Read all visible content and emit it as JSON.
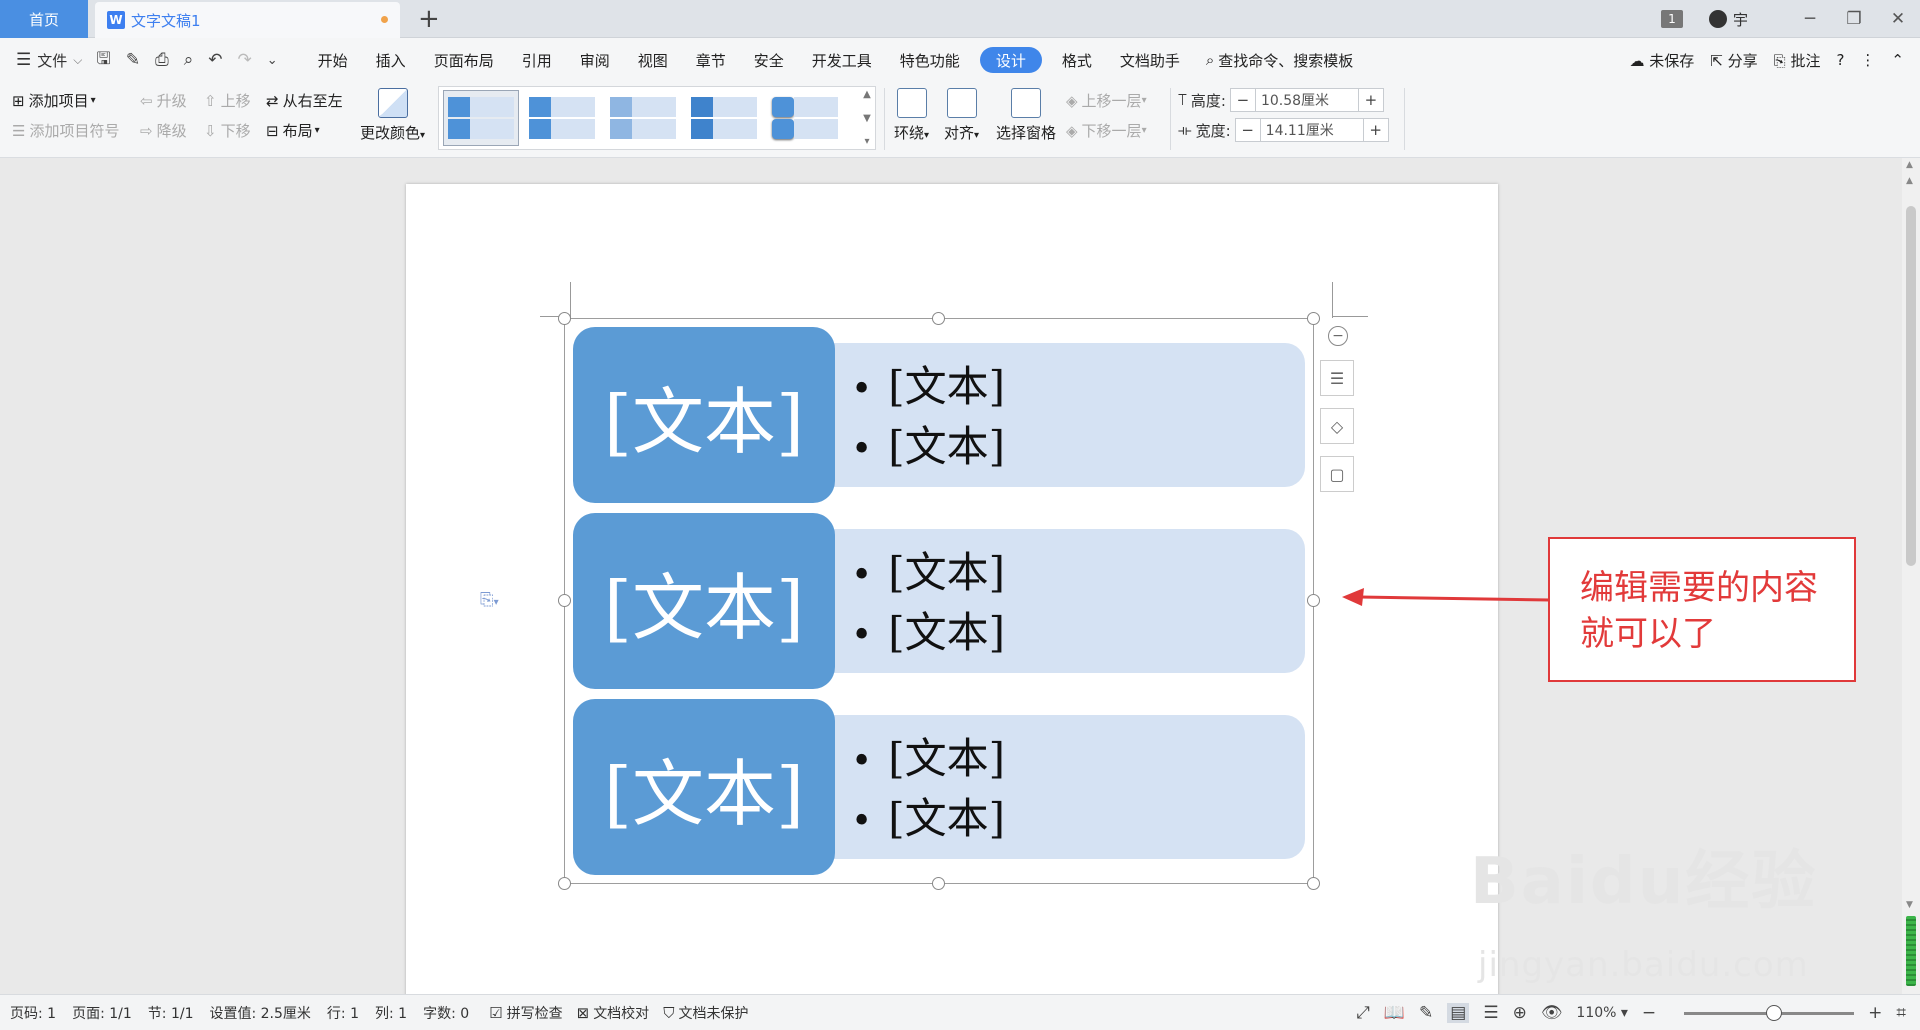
{
  "tabs": {
    "home": "首页",
    "doc_title": "文字文稿1",
    "add": "+"
  },
  "window": {
    "count_badge": "1",
    "user": "宇"
  },
  "menubar": {
    "file": "文件",
    "tabs": [
      "开始",
      "插入",
      "页面布局",
      "引用",
      "审阅",
      "视图",
      "章节",
      "安全",
      "开发工具",
      "特色功能",
      "设计",
      "格式",
      "文档助手"
    ],
    "active_tab": "设计",
    "search": "查找命令、搜索模板",
    "unsaved": "未保存",
    "share": "分享",
    "comment": "批注"
  },
  "ribbon": {
    "add_item": "添加项目",
    "add_bullet": "添加项目符号",
    "promote": "升级",
    "demote": "降级",
    "move_up": "上移",
    "move_down": "下移",
    "right_to_left": "从右至左",
    "layout": "布局",
    "change_color": "更改颜色",
    "wrap": "环绕",
    "align": "对齐",
    "selection_pane": "选择窗格",
    "bring_forward": "上移一层",
    "send_backward": "下移一层",
    "height_label": "高度:",
    "height_value": "10.58厘米",
    "width_label": "宽度:",
    "width_value": "14.11厘米"
  },
  "smartart": {
    "rows": [
      {
        "label": "[文本]",
        "bullets": [
          "[文本]",
          "[文本]"
        ]
      },
      {
        "label": "[文本]",
        "bullets": [
          "[文本]",
          "[文本]"
        ]
      },
      {
        "label": "[文本]",
        "bullets": [
          "[文本]",
          "[文本]"
        ]
      }
    ],
    "fill_dark": "#5b9bd5",
    "fill_light": "#d5e2f3"
  },
  "annotation": {
    "line1": "编辑需要的内容",
    "line2": "就可以了",
    "color": "#e0393a"
  },
  "watermark": {
    "brand": "Baidu经验",
    "url": "jingyan.baidu.com"
  },
  "statusbar": {
    "page_num": "页码: 1",
    "pages": "页面: 1/1",
    "section": "节: 1/1",
    "setting": "设置值: 2.5厘米",
    "row": "行: 1",
    "col": "列: 1",
    "words": "字数: 0",
    "spell_check": "拼写检查",
    "proofread": "文档校对",
    "protect": "文档未保护",
    "zoom": "110%"
  }
}
